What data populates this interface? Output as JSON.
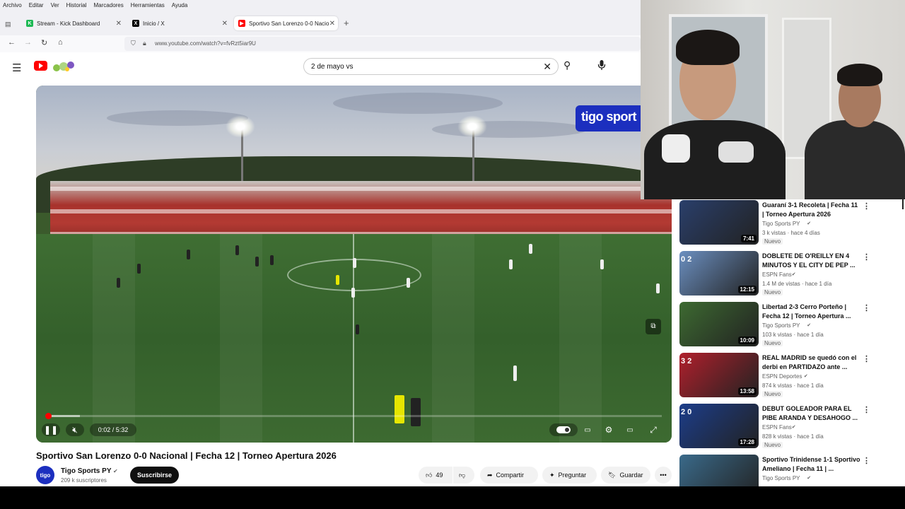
{
  "browser": {
    "menu": [
      "Archivo",
      "Editar",
      "Ver",
      "Historial",
      "Marcadores",
      "Herramientas",
      "Ayuda"
    ],
    "tabs": [
      {
        "label": "Stream - Kick Dashboard",
        "icon": "kick-icon",
        "color": "#1db954"
      },
      {
        "label": "Inicio / X",
        "icon": "x-logo-icon",
        "color": "#000000"
      },
      {
        "label": "Sportivo San Lorenzo 0-0 Nacio",
        "icon": "youtube-icon",
        "color": "#ff0000"
      }
    ],
    "url": "www.youtube.com/watch?v=fvRzt5iar9U"
  },
  "youtube": {
    "search_query": "2 de mayo vs",
    "video": {
      "title": "Sportivo San Lorenzo 0-0 Nacional | Fecha 12 | Torneo Apertura 2026",
      "time": "0:02 / 5:32",
      "progress_played": 0.003,
      "progress_buffered": 0.055,
      "overlay_logo": "tigo sport"
    },
    "channel": {
      "name": "Tigo Sports PY",
      "avatar_text": "tigo",
      "subscribers": "209 k suscriptores",
      "subscribe_label": "Suscribirse"
    },
    "actions": {
      "likes": "49",
      "share": "Compartir",
      "ask": "Preguntar",
      "save": "Guardar"
    },
    "recommendations": [
      {
        "title": "Guaraní 3-1 Recoleta | Fecha 11 | Torneo Apertura 2026",
        "channel": "Tigo Sports PY",
        "meta": "3 k vistas · hace 4 días",
        "badge": "Nuevo",
        "duration": "7:41",
        "thumb_color": "#2a3f6b",
        "overlay": ""
      },
      {
        "title": "DOBLETE DE O'REILLY EN 4 MINUTOS Y EL CITY DE PEP ...",
        "channel": "ESPN Fans",
        "meta": "1.4 M de vistas · hace 1 día",
        "badge": "Nuevo",
        "duration": "12:15",
        "thumb_color": "#6b8fc0",
        "overlay": "0 2"
      },
      {
        "title": "Libertad 2-3 Cerro Porteño | Fecha 12 | Torneo Apertura ...",
        "channel": "Tigo Sports PY",
        "meta": "103 k vistas · hace 1 día",
        "badge": "Nuevo",
        "duration": "10:09",
        "thumb_color": "#3d6a31",
        "overlay": ""
      },
      {
        "title": "REAL MADRID se quedó con el derbi en PARTIDAZO ante ...",
        "channel": "ESPN Deportes",
        "meta": "874 k vistas · hace 1 día",
        "badge": "Nuevo",
        "duration": "13:58",
        "thumb_color": "#b0202c",
        "overlay": "3 2"
      },
      {
        "title": "DEBUT GOLEADOR PARA EL PIBE ARANDA Y DESAHOGO ...",
        "channel": "ESPN Fans",
        "meta": "828 k vistas · hace 1 día",
        "badge": "Nuevo",
        "duration": "17:28",
        "thumb_color": "#1c3d8a",
        "overlay": "2 0"
      },
      {
        "title": "Sportivo Trinidense 1-1 Sportivo Ameliano | Fecha 11 | ...",
        "channel": "Tigo Sports PY",
        "meta": "",
        "badge": "",
        "duration": "",
        "thumb_color": "#3a6a8a",
        "overlay": ""
      }
    ]
  }
}
